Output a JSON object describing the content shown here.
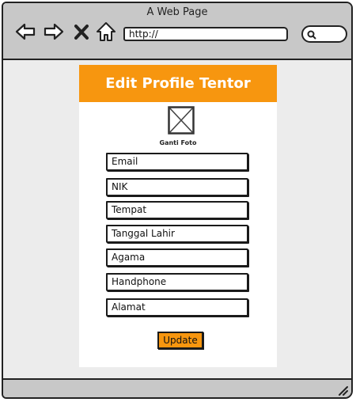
{
  "browser": {
    "title": "A Web Page",
    "url": "http://",
    "nav_icons": [
      "back-arrow-icon",
      "forward-arrow-icon",
      "close-x-icon",
      "home-icon",
      "search-icon"
    ]
  },
  "form": {
    "header": "Edit Profile Tentor",
    "photo_caption": "Ganti Foto",
    "fields": [
      {
        "placeholder": "Email"
      },
      {
        "placeholder": "NIK"
      },
      {
        "placeholder": "Tempat"
      },
      {
        "placeholder": "Tanggal Lahir"
      },
      {
        "placeholder": "Agama"
      },
      {
        "placeholder": "Handphone"
      },
      {
        "placeholder": "Alamat"
      }
    ],
    "submit_label": "Update"
  },
  "colors": {
    "accent": "#f7960f",
    "chrome": "#c8c8c8",
    "page_bg": "#ececec"
  }
}
